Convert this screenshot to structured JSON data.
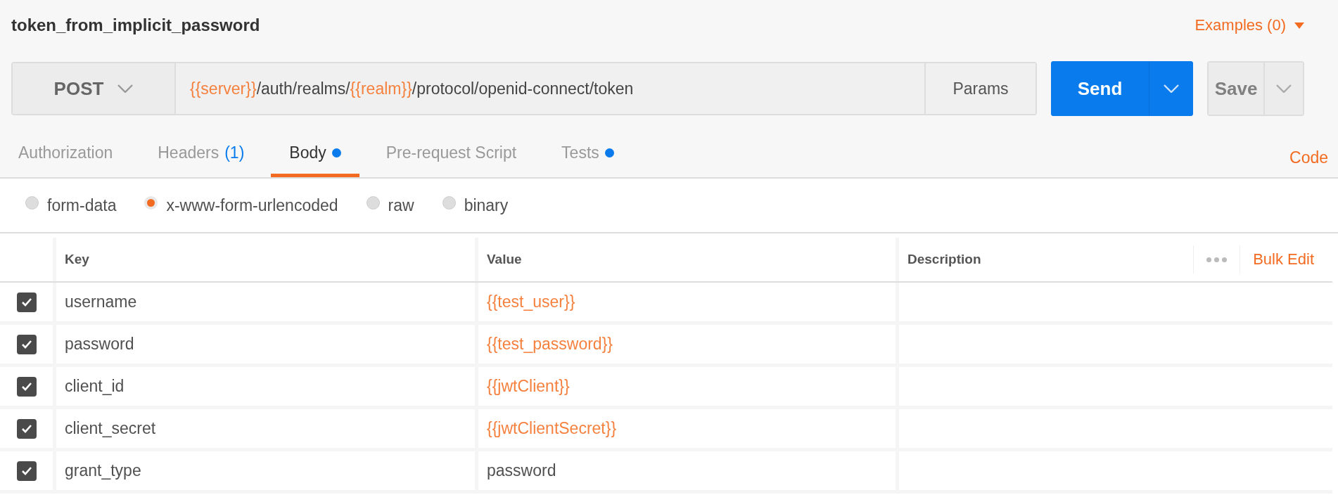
{
  "request_name": "token_from_implicit_password",
  "examples": {
    "label": "Examples (0)"
  },
  "method": {
    "label": "POST"
  },
  "url": {
    "segments": [
      {
        "text": "{{server}}",
        "kind": "variable"
      },
      {
        "text": "/auth/realms/",
        "kind": "text"
      },
      {
        "text": "{{realm}}",
        "kind": "variable"
      },
      {
        "text": "/protocol/openid-connect/token",
        "kind": "text"
      }
    ]
  },
  "params_button": "Params",
  "send_button": "Send",
  "save_button": "Save",
  "tabs": [
    {
      "label": "Authorization",
      "selected": false,
      "dot": false
    },
    {
      "label": "Headers",
      "count": "(1)",
      "selected": false,
      "dot": false
    },
    {
      "label": "Body",
      "selected": true,
      "dot": true
    },
    {
      "label": "Pre-request Script",
      "selected": false,
      "dot": false
    },
    {
      "label": "Tests",
      "selected": false,
      "dot": true
    }
  ],
  "code_link": "Code",
  "body_types": [
    {
      "label": "form-data",
      "selected": false
    },
    {
      "label": "x-www-form-urlencoded",
      "selected": true
    },
    {
      "label": "raw",
      "selected": false
    },
    {
      "label": "binary",
      "selected": false
    }
  ],
  "table": {
    "columns": [
      "Key",
      "Value",
      "Description"
    ],
    "bulk_edit": "Bulk Edit",
    "rows": [
      {
        "checked": true,
        "key": "username",
        "value": "{{test_user}}",
        "variable": true
      },
      {
        "checked": true,
        "key": "password",
        "value": "{{test_password}}",
        "variable": true
      },
      {
        "checked": true,
        "key": "client_id",
        "value": "{{jwtClient}}",
        "variable": true
      },
      {
        "checked": true,
        "key": "client_secret",
        "value": "{{jwtClientSecret}}",
        "variable": true
      },
      {
        "checked": true,
        "key": "grant_type",
        "value": "password",
        "variable": false
      }
    ]
  }
}
